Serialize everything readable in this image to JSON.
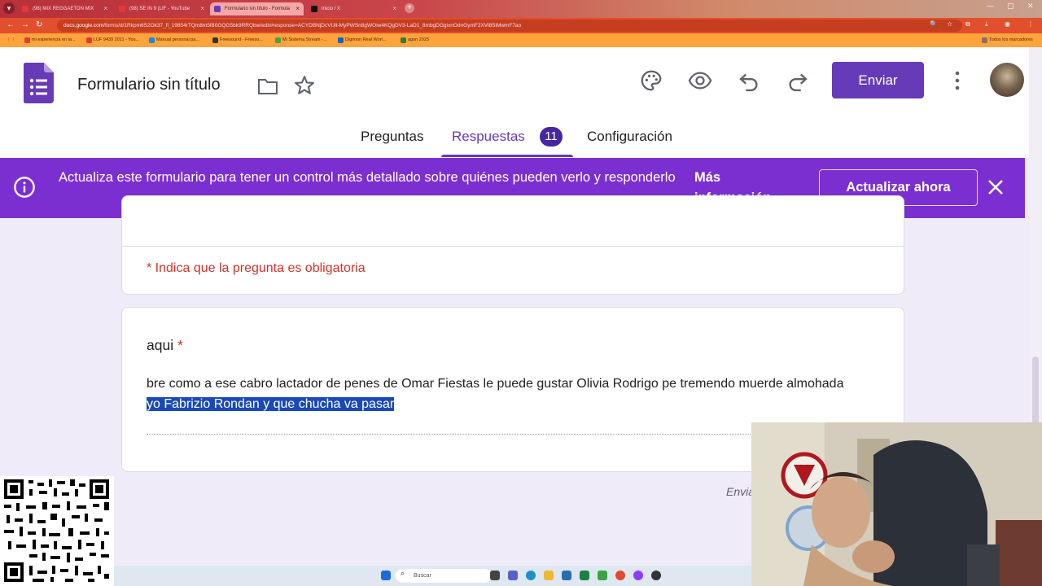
{
  "browser": {
    "tabs": [
      {
        "label": "(98) MIX REGGAETON MIX",
        "active": false
      },
      {
        "label": "(98) SE IN 9 (LIF - YouTube",
        "active": false
      },
      {
        "label": "Formulario sin título - Formula",
        "active": true
      },
      {
        "label": "Inicio / X",
        "active": false
      }
    ],
    "url_host": "docs.google.com",
    "url_path": "/forms/d/1Rkpm6S2Ok37_fl_19854rTQm8m5lB0GQG5bk9RRQbw/edit#response=ACYDBNjDcVUlt-MyPWSn8gWOiw4KQgDV3-LaD1_8mbgDGgivnOdnGymF2XVl8SlMwmF7ao",
    "bookmarks": [
      "mi experiencia en la...",
      "LUF 9439 2011 - You...",
      "Manual personal pa...",
      "Freesound - Freeso...",
      "Mi Sistema Stream -...",
      "Digimon Real Worl...",
      "agon 2025"
    ],
    "bookmarks_right": "Todos los marcadores"
  },
  "header": {
    "title": "Formulario sin título",
    "send_label": "Enviar"
  },
  "tabs": {
    "questions": "Preguntas",
    "responses": "Respuestas",
    "responses_count": "11",
    "settings": "Configuración"
  },
  "banner": {
    "text": "Actualiza este formulario para tener un control más detallado sobre quiénes pueden verlo y responderlo",
    "more_info": "Más información",
    "update_button": "Actualizar ahora"
  },
  "form": {
    "required_note": "* Indica que la pregunta es obligatoria",
    "question_title": "aqui",
    "required_mark": "*",
    "answer_text": "bre como a ese cabro lactador de penes de Omar Fiestas le puede gustar Olivia Rodrigo pe tremendo muerde almohada",
    "answer_selected": "yo Fabrizio Rondan y que chucha va pasar",
    "send_partial": "Envia"
  },
  "taskbar": {
    "search_placeholder": "Buscar"
  },
  "colors": {
    "forms_purple": "#673ab7",
    "banner_purple": "#7c2fd0",
    "required_red": "#d93025",
    "selection_blue": "#1a49b8"
  }
}
